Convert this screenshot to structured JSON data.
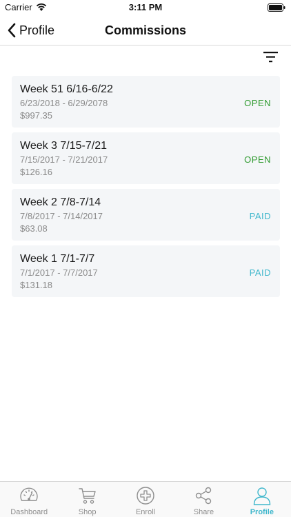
{
  "status_bar": {
    "carrier": "Carrier",
    "time": "3:11 PM"
  },
  "nav": {
    "back_label": "Profile",
    "title": "Commissions"
  },
  "colors": {
    "open": "#2e9a2e",
    "paid": "#3fb7cc",
    "tab_inactive": "#8e8e8e",
    "tab_active": "#3fb7cc"
  },
  "commissions": [
    {
      "title": "Week 51 6/16-6/22",
      "range": "6/23/2018 - 6/29/2078",
      "amount": "$997.35",
      "status": "OPEN"
    },
    {
      "title": "Week 3 7/15-7/21",
      "range": "7/15/2017 - 7/21/2017",
      "amount": "$126.16",
      "status": "OPEN"
    },
    {
      "title": "Week 2 7/8-7/14",
      "range": "7/8/2017 - 7/14/2017",
      "amount": "$63.08",
      "status": "PAID"
    },
    {
      "title": "Week 1 7/1-7/7",
      "range": "7/1/2017 - 7/7/2017",
      "amount": "$131.18",
      "status": "PAID"
    }
  ],
  "tabs": [
    {
      "label": "Dashboard",
      "icon": "speedometer-icon",
      "active": false
    },
    {
      "label": "Shop",
      "icon": "cart-icon",
      "active": false
    },
    {
      "label": "Enroll",
      "icon": "plus-circle-icon",
      "active": false
    },
    {
      "label": "Share",
      "icon": "share-icon",
      "active": false
    },
    {
      "label": "Profile",
      "icon": "person-icon",
      "active": true
    }
  ]
}
